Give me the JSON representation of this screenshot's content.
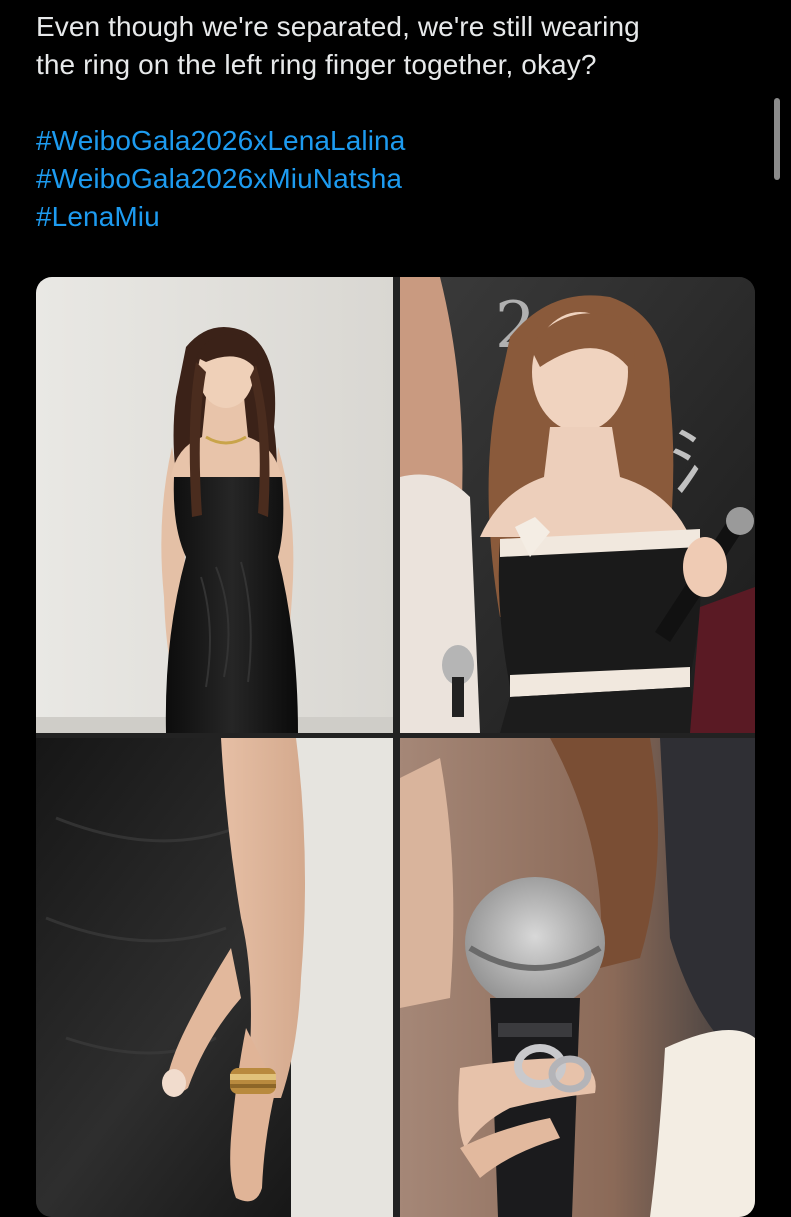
{
  "tweet": {
    "text_line1": "Even though we're separated, we're still wearing",
    "text_line2": "the ring on the left ring finger together, okay?",
    "hashtags": [
      "#WeiboGala2026xLenaLalina",
      "#WeiboGala2026xMiuNatsha",
      "#LenaMiu"
    ]
  },
  "media": {
    "photos": [
      {
        "label": "woman in black strapless velvet dress"
      },
      {
        "label": "woman in black and white strapless dress holding microphone"
      },
      {
        "label": "close-up hand with gold ring"
      },
      {
        "label": "close-up hand with silver ring and microphone"
      }
    ]
  },
  "colors": {
    "background": "#000000",
    "text": "#e7e9ea",
    "link": "#1d9bf0"
  }
}
